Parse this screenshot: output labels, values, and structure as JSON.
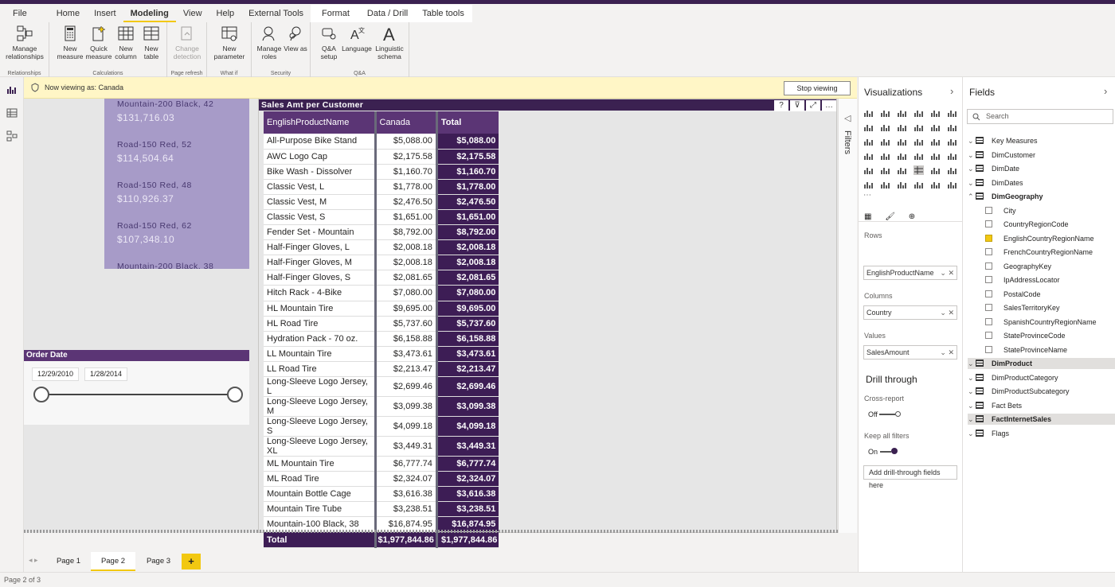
{
  "menu": {
    "tabs": [
      "File",
      "Home",
      "Insert",
      "Modeling",
      "View",
      "Help",
      "External Tools",
      "Format",
      "Data / Drill",
      "Table tools"
    ],
    "active": "Modeling"
  },
  "ribbon": {
    "manage_relationships": "Manage relationships",
    "grp_relationships": "Relationships",
    "new_measure": "New measure",
    "quick_measure": "Quick measure",
    "new_column": "New column",
    "new_table": "New table",
    "grp_calculations": "Calculations",
    "change_detection": "Change detection",
    "grp_page_refresh": "Page refresh",
    "new_parameter": "New parameter",
    "grp_what_if": "What if",
    "manage_roles": "Manage roles",
    "view_as": "View as",
    "grp_security": "Security",
    "qa_setup": "Q&A setup",
    "language": "Language",
    "linguistic_schema": "Linguistic schema",
    "grp_qa": "Q&A"
  },
  "viewbar": {
    "text": "Now viewing as: Canada",
    "stop": "Stop viewing"
  },
  "card_list": [
    {
      "name": "Mountain-200 Black, 42",
      "value": "$131,716.03"
    },
    {
      "name": "Road-150 Red, 52",
      "value": "$114,504.64"
    },
    {
      "name": "Road-150 Red, 48",
      "value": "$110,926.37"
    },
    {
      "name": "Road-150 Red, 62",
      "value": "$107,348.10"
    },
    {
      "name": "Mountain-200 Black, 38",
      "value": ""
    }
  ],
  "slicer": {
    "title": "Order Date",
    "start": "12/29/2010",
    "end": "1/28/2014"
  },
  "matrix": {
    "title": "Sales Amt per Customer",
    "col_product": "EnglishProductName",
    "col_country": "Canada",
    "col_total": "Total",
    "rows": [
      [
        "All-Purpose Bike Stand",
        "$5,088.00",
        "$5,088.00"
      ],
      [
        "AWC Logo Cap",
        "$2,175.58",
        "$2,175.58"
      ],
      [
        "Bike Wash - Dissolver",
        "$1,160.70",
        "$1,160.70"
      ],
      [
        "Classic Vest, L",
        "$1,778.00",
        "$1,778.00"
      ],
      [
        "Classic Vest, M",
        "$2,476.50",
        "$2,476.50"
      ],
      [
        "Classic Vest, S",
        "$1,651.00",
        "$1,651.00"
      ],
      [
        "Fender Set - Mountain",
        "$8,792.00",
        "$8,792.00"
      ],
      [
        "Half-Finger Gloves, L",
        "$2,008.18",
        "$2,008.18"
      ],
      [
        "Half-Finger Gloves, M",
        "$2,008.18",
        "$2,008.18"
      ],
      [
        "Half-Finger Gloves, S",
        "$2,081.65",
        "$2,081.65"
      ],
      [
        "Hitch Rack - 4-Bike",
        "$7,080.00",
        "$7,080.00"
      ],
      [
        "HL Mountain Tire",
        "$9,695.00",
        "$9,695.00"
      ],
      [
        "HL Road Tire",
        "$5,737.60",
        "$5,737.60"
      ],
      [
        "Hydration Pack - 70 oz.",
        "$6,158.88",
        "$6,158.88"
      ],
      [
        "LL Mountain Tire",
        "$3,473.61",
        "$3,473.61"
      ],
      [
        "LL Road Tire",
        "$2,213.47",
        "$2,213.47"
      ],
      [
        "Long-Sleeve Logo Jersey, L",
        "$2,699.46",
        "$2,699.46"
      ],
      [
        "Long-Sleeve Logo Jersey, M",
        "$3,099.38",
        "$3,099.38"
      ],
      [
        "Long-Sleeve Logo Jersey, S",
        "$4,099.18",
        "$4,099.18"
      ],
      [
        "Long-Sleeve Logo Jersey, XL",
        "$3,449.31",
        "$3,449.31"
      ],
      [
        "ML Mountain Tire",
        "$6,777.74",
        "$6,777.74"
      ],
      [
        "ML Road Tire",
        "$2,324.07",
        "$2,324.07"
      ],
      [
        "Mountain Bottle Cage",
        "$3,616.38",
        "$3,616.38"
      ],
      [
        "Mountain Tire Tube",
        "$3,238.51",
        "$3,238.51"
      ],
      [
        "Mountain-100 Black, 38",
        "$16,874.95",
        "$16,874.95"
      ]
    ],
    "total_label": "Total",
    "total_country": "$1,977,844.86",
    "total_total": "$1,977,844.86"
  },
  "filters_label": "Filters",
  "pages": {
    "tabs": [
      "Page 1",
      "Page 2",
      "Page 3"
    ],
    "active": "Page 2",
    "add": "+"
  },
  "status": "Page 2 of 3",
  "viz": {
    "title": "Visualizations",
    "rows_label": "Rows",
    "rows_field": "EnglishProductName",
    "columns_label": "Columns",
    "columns_field": "Country",
    "values_label": "Values",
    "values_field": "SalesAmount",
    "drill_title": "Drill through",
    "cross_report": "Cross-report",
    "cross_state": "Off",
    "keep_filters": "Keep all filters",
    "keep_state": "On",
    "add_drill": "Add drill-through fields here"
  },
  "fields": {
    "title": "Fields",
    "search": "Search",
    "items": [
      {
        "label": "Key Measures",
        "kind": "measure"
      },
      {
        "label": "DimCustomer",
        "kind": "table"
      },
      {
        "label": "DimDate",
        "kind": "table"
      },
      {
        "label": "DimDates",
        "kind": "table"
      },
      {
        "label": "DimGeography",
        "kind": "table-open"
      },
      {
        "label": "City",
        "kind": "field"
      },
      {
        "label": "CountryRegionCode",
        "kind": "field"
      },
      {
        "label": "EnglishCountryRegionName",
        "kind": "field-checked"
      },
      {
        "label": "FrenchCountryRegionName",
        "kind": "field"
      },
      {
        "label": "GeographyKey",
        "kind": "field"
      },
      {
        "label": "IpAddressLocator",
        "kind": "field"
      },
      {
        "label": "PostalCode",
        "kind": "field"
      },
      {
        "label": "SalesTerritoryKey",
        "kind": "field"
      },
      {
        "label": "SpanishCountryRegionName",
        "kind": "field"
      },
      {
        "label": "StateProvinceCode",
        "kind": "field"
      },
      {
        "label": "StateProvinceName",
        "kind": "field"
      },
      {
        "label": "DimProduct",
        "kind": "table-used"
      },
      {
        "label": "DimProductCategory",
        "kind": "table"
      },
      {
        "label": "DimProductSubcategory",
        "kind": "table"
      },
      {
        "label": "Fact Bets",
        "kind": "table"
      },
      {
        "label": "FactInternetSales",
        "kind": "table-used"
      },
      {
        "label": "Flags",
        "kind": "table"
      }
    ]
  },
  "colors": {
    "accent": "#f2c811",
    "brand": "#3b2151",
    "header": "#5b3575",
    "card": "#a79bc8"
  }
}
